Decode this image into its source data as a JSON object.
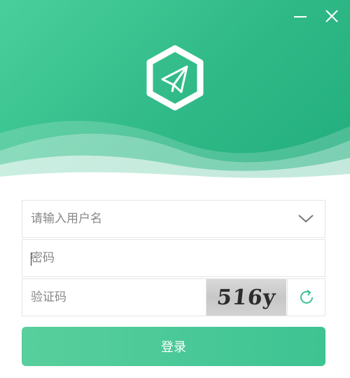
{
  "window": {
    "minimize_icon": "minimize-icon",
    "close_icon": "close-icon"
  },
  "header": {
    "logo_icon": "paper-plane-hexagon-icon",
    "gradient_start": "#49cf9b",
    "gradient_end": "#22ad7d"
  },
  "form": {
    "username": {
      "value": "",
      "placeholder": "请输入用户名",
      "dropdown_icon": "chevron-down-icon"
    },
    "password": {
      "value": "",
      "placeholder": "密码"
    },
    "captcha": {
      "value": "",
      "placeholder": "验证码",
      "image_text": "516y",
      "refresh_icon": "refresh-icon"
    },
    "login_label": "登录"
  },
  "colors": {
    "accent": "#3ec392",
    "border": "#e3e7e5"
  }
}
